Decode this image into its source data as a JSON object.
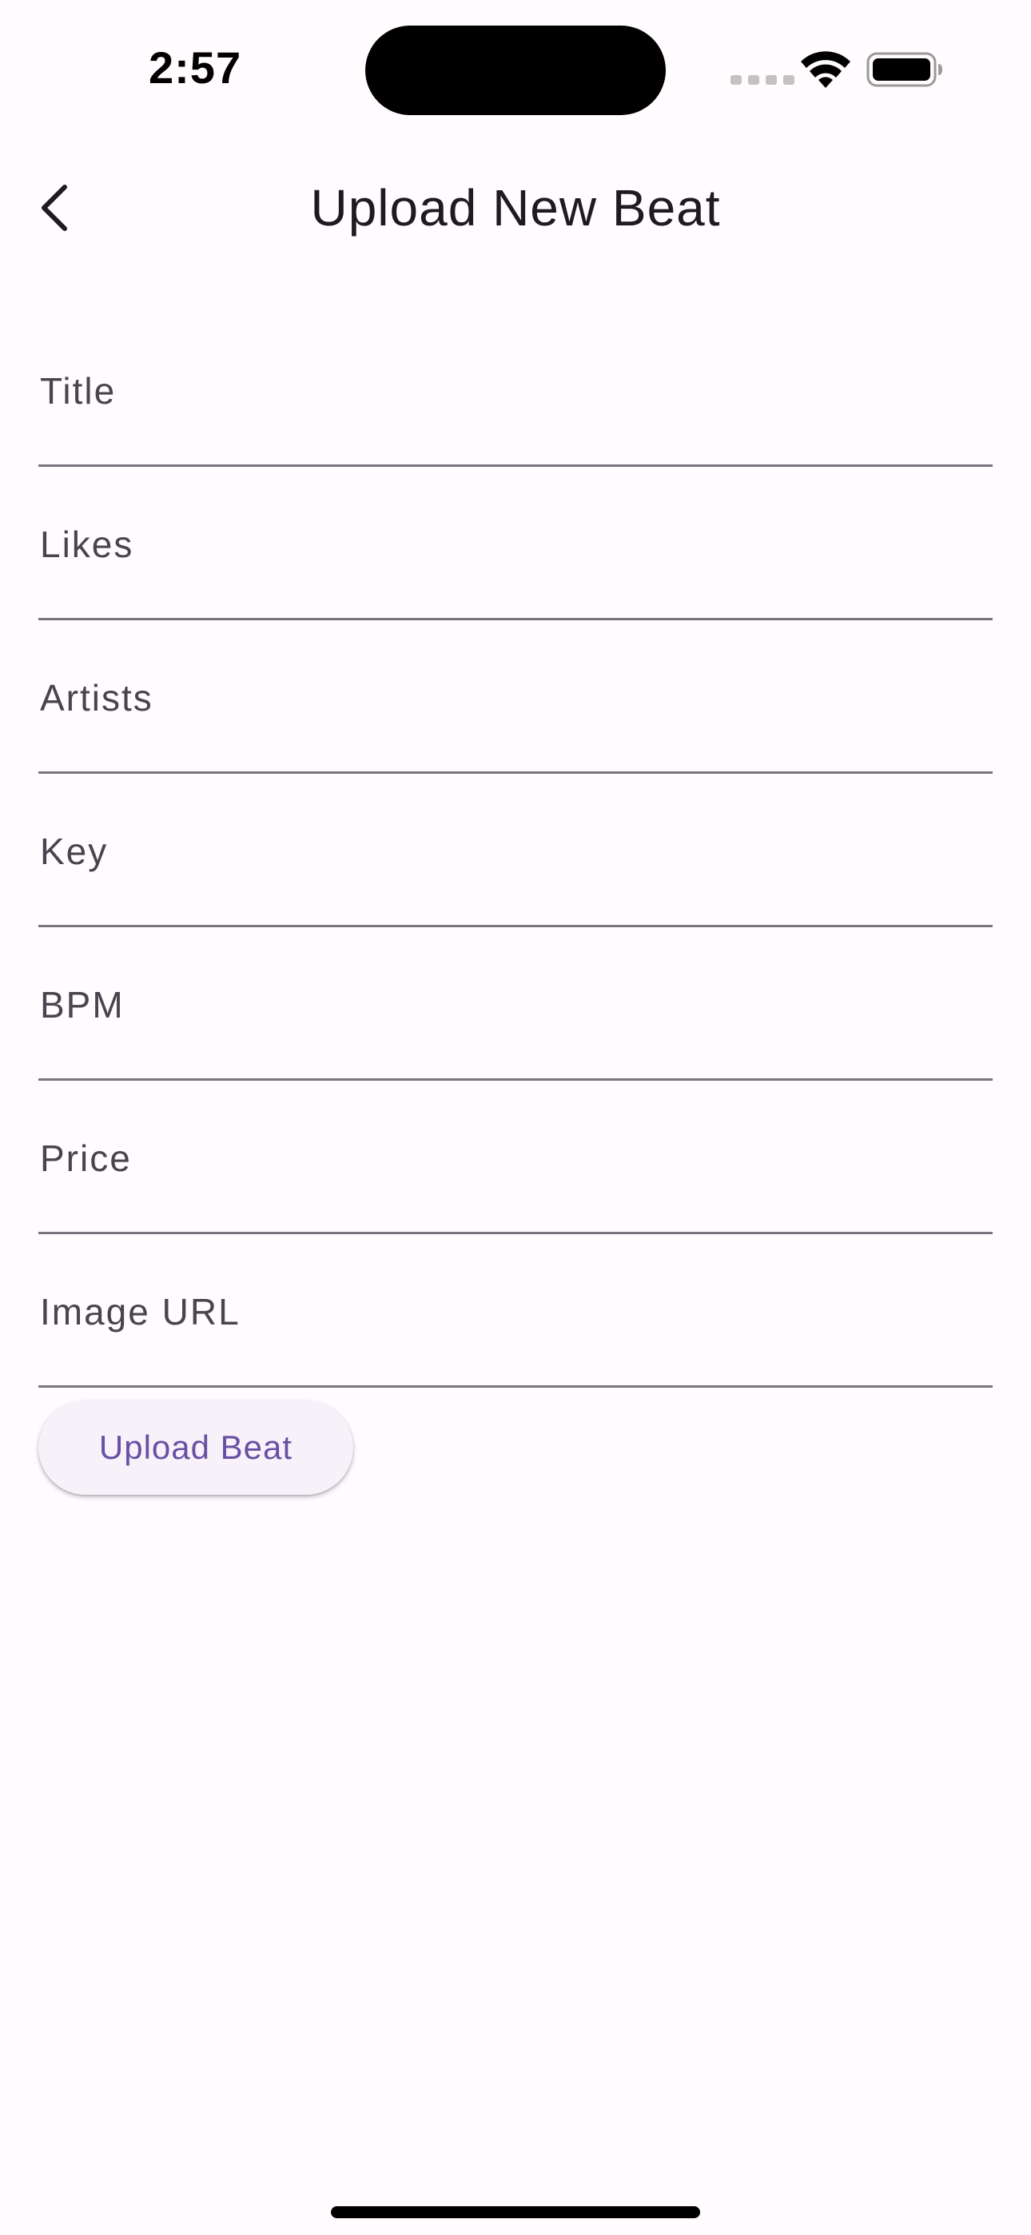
{
  "status_bar": {
    "time": "2:57"
  },
  "app_bar": {
    "title": "Upload New Beat",
    "back_icon": "chevron-left-icon"
  },
  "form": {
    "fields": [
      {
        "label": "Title",
        "value": ""
      },
      {
        "label": "Likes",
        "value": ""
      },
      {
        "label": "Artists",
        "value": ""
      },
      {
        "label": "Key",
        "value": ""
      },
      {
        "label": "BPM",
        "value": ""
      },
      {
        "label": "Price",
        "value": ""
      },
      {
        "label": "Image URL",
        "value": ""
      }
    ],
    "submit_label": "Upload Beat"
  },
  "colors": {
    "background": "#fffbfe",
    "accent": "#6750a4",
    "underline": "#79747e",
    "label": "#49454f"
  }
}
